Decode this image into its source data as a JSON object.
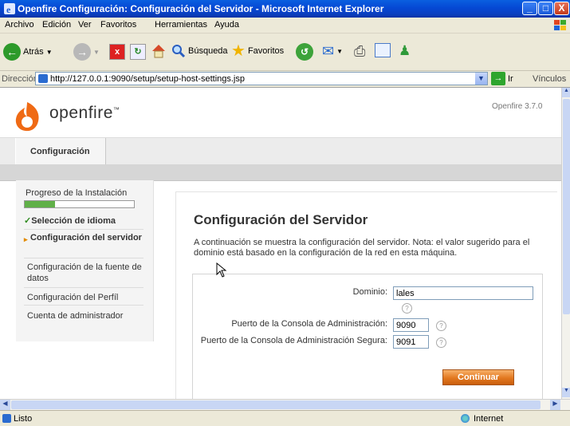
{
  "window": {
    "title": "Openfire Configuración: Configuración del Servidor - Microsoft Internet Explorer",
    "minimize": "_",
    "maximize": "□",
    "close": "X"
  },
  "menu": [
    "Archivo",
    "Edición",
    "Ver",
    "Favoritos",
    "Herramientas",
    "Ayuda"
  ],
  "toolbar": {
    "back": "Atrás",
    "search": "Búsqueda",
    "favorites": "Favoritos"
  },
  "address": {
    "label": "Dirección",
    "url": "http://127.0.0.1:9090/setup/setup-host-settings.jsp",
    "go": "Ir",
    "links": "Vínculos"
  },
  "page": {
    "logo_text": "openfire",
    "logo_tm": "™",
    "version": "Openfire 3.7.0",
    "tab": "Configuración",
    "sidebar": {
      "progress_label": "Progreso de la Instalación",
      "progress": 0.28,
      "steps": [
        {
          "label": "Selección de idioma",
          "state": "done"
        },
        {
          "label": "Configuración del servidor",
          "state": "active"
        },
        {
          "label": "Configuración de la fuente de datos",
          "state": "pending"
        },
        {
          "label": "Configuración del Perfíl",
          "state": "pending"
        },
        {
          "label": "Cuenta de administrador",
          "state": "pending"
        }
      ]
    },
    "heading": "Configuración del Servidor",
    "intro": "A continuación se muestra la configuración del servidor. Nota: el valor sugerido para el dominio está basado en la configuración de la red en esta máquina.",
    "form": {
      "domain_label": "Dominio:",
      "domain_value": "lales",
      "admin_port_label": "Puerto de la Consola de Administración:",
      "admin_port_value": "9090",
      "secure_port_label": "Puerto de la Consola de Administración Segura:",
      "secure_port_value": "9091",
      "help": "?",
      "continue": "Continuar"
    }
  },
  "status": {
    "text": "Listo",
    "zone": "Internet"
  }
}
